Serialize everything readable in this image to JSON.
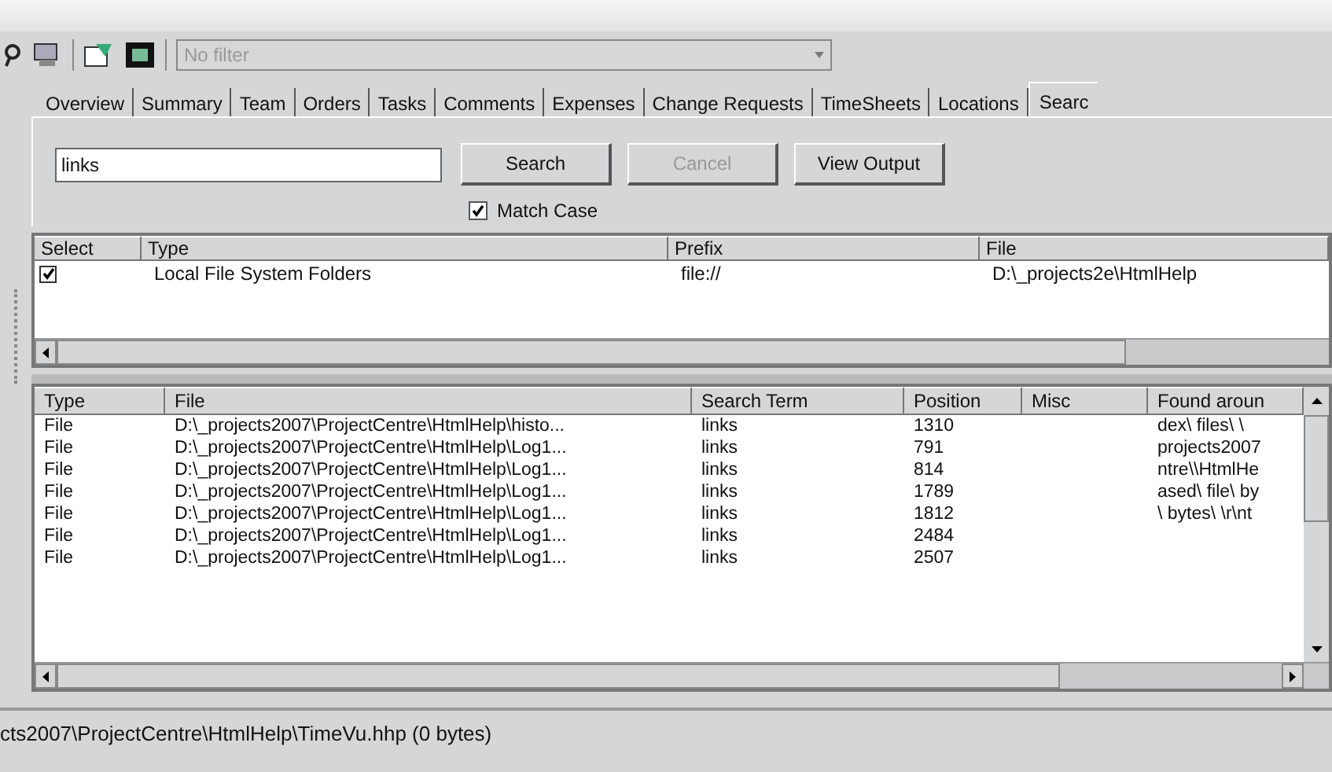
{
  "toolbar": {
    "filter": {
      "placeholder": "No filter"
    }
  },
  "tabs": [
    {
      "label": "Overview",
      "selected": false
    },
    {
      "label": "Summary",
      "selected": false
    },
    {
      "label": "Team",
      "selected": false
    },
    {
      "label": "Orders",
      "selected": false
    },
    {
      "label": "Tasks",
      "selected": false
    },
    {
      "label": "Comments",
      "selected": false
    },
    {
      "label": "Expenses",
      "selected": false
    },
    {
      "label": "Change Requests",
      "selected": false
    },
    {
      "label": "TimeSheets",
      "selected": false
    },
    {
      "label": "Locations",
      "selected": false
    },
    {
      "label": "Searc",
      "selected": true
    }
  ],
  "search": {
    "value": "links",
    "buttons": [
      {
        "label": "Search",
        "disabled": false
      },
      {
        "label": "Cancel",
        "disabled": true
      },
      {
        "label": "View Output",
        "disabled": false
      }
    ],
    "match_case": {
      "label": "Match Case",
      "checked": true
    }
  },
  "sources": {
    "columns": [
      "Select",
      "Type",
      "Prefix",
      "File"
    ],
    "rows": [
      {
        "checked": true,
        "type": "Local File System Folders",
        "prefix": "file://",
        "file": "D:\\_projects2e\\HtmlHelp"
      }
    ]
  },
  "results": {
    "columns": [
      "Type",
      "File",
      "Search Term",
      "Position",
      "Misc",
      "Found aroun"
    ],
    "rows": [
      [
        "File",
        "D:\\_projects2007\\ProjectCentre\\HtmlHelp\\histo...",
        "links",
        "1310",
        "",
        "dex\\ files\\ \\"
      ],
      [
        "File",
        "D:\\_projects2007\\ProjectCentre\\HtmlHelp\\Log1...",
        "links",
        "791",
        "",
        "projects2007"
      ],
      [
        "File",
        "D:\\_projects2007\\ProjectCentre\\HtmlHelp\\Log1...",
        "links",
        "814",
        "",
        "ntre\\\\HtmlHe"
      ],
      [
        "File",
        "D:\\_projects2007\\ProjectCentre\\HtmlHelp\\Log1...",
        "links",
        "1789",
        "",
        "ased\\ file\\ by"
      ],
      [
        "File",
        "D:\\_projects2007\\ProjectCentre\\HtmlHelp\\Log1...",
        "links",
        "1812",
        "",
        "\\ bytes\\ \\r\\nt"
      ],
      [
        "File",
        "D:\\_projects2007\\ProjectCentre\\HtmlHelp\\Log1...",
        "links",
        "2484",
        "",
        ""
      ],
      [
        "File",
        "D:\\_projects2007\\ProjectCentre\\HtmlHelp\\Log1...",
        "links",
        "2507",
        "",
        ""
      ]
    ]
  },
  "status_bar": "cts2007\\ProjectCentre\\HtmlHelp\\TimeVu.hhp (0 bytes)"
}
